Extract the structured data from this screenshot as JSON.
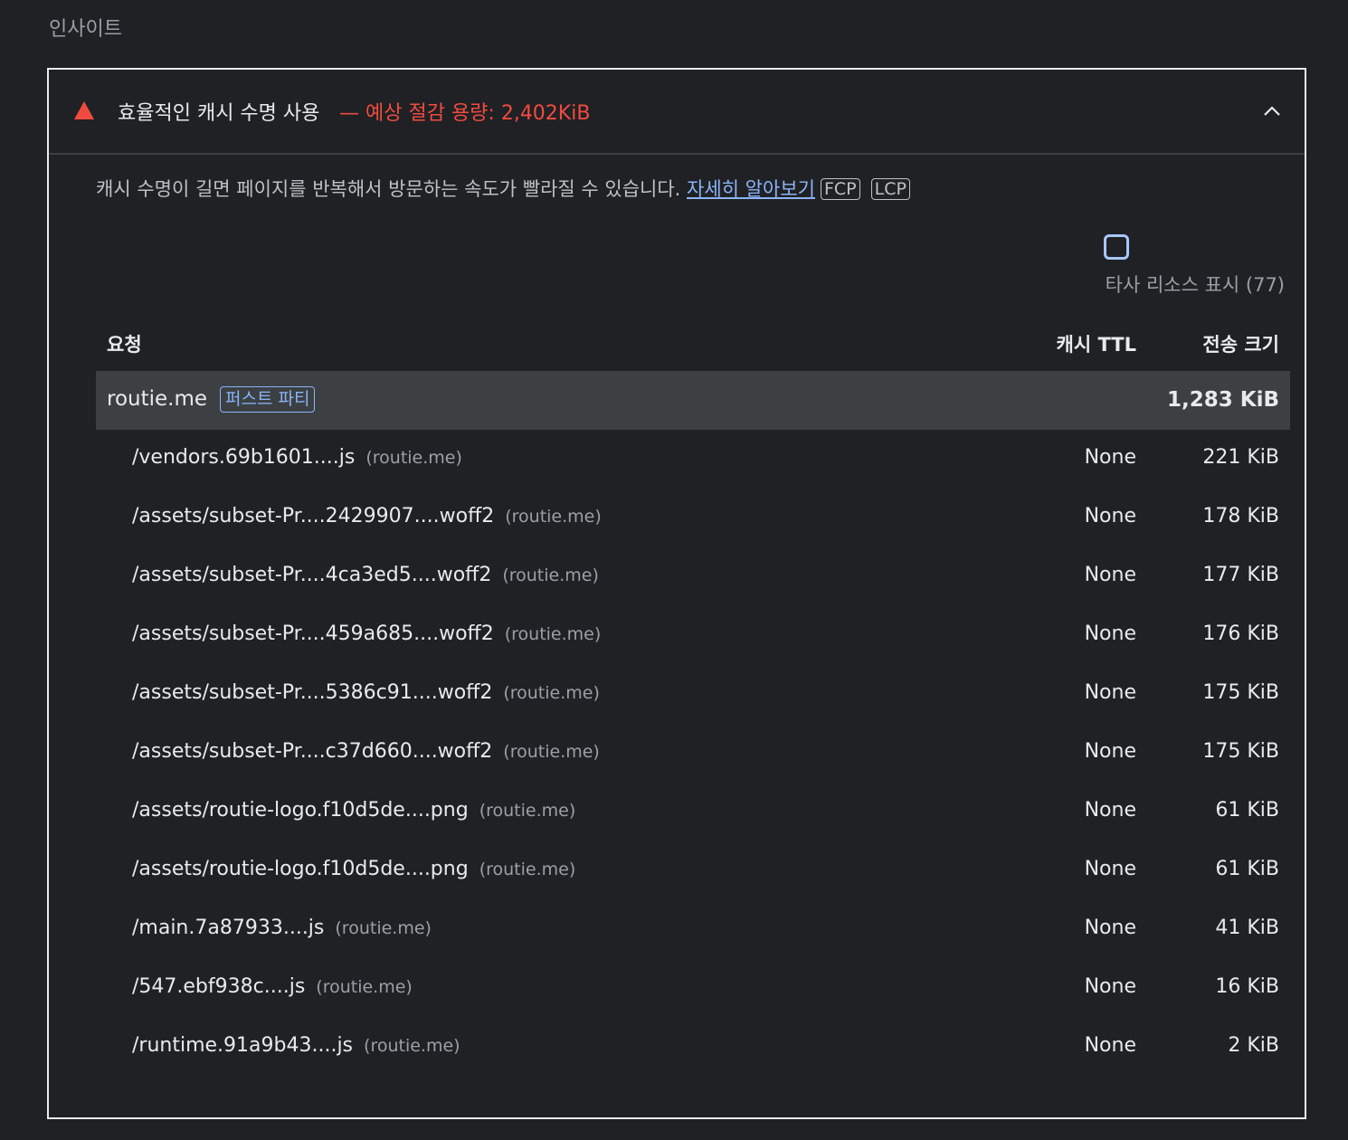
{
  "section_title": "인사이트",
  "insight": {
    "title": "효율적인 캐시 수명 사용",
    "savings": "— 예상 절감 용량: 2,402KiB",
    "description": "캐시 수명이 길면 페이지를 반복해서 방문하는 속도가 빨라질 수 있습니다.",
    "learn_more": "자세히 알아보기",
    "metrics": [
      "FCP",
      "LCP"
    ],
    "warning_color": "#f14b40",
    "expanded": true
  },
  "third_party": {
    "label": "타사 리소스 표시 (77)",
    "checked": false
  },
  "table": {
    "headers": {
      "request": "요청",
      "ttl": "캐시 TTL",
      "size": "전송 크기"
    },
    "group": {
      "name": "routie.me",
      "badge": "퍼스트 파티",
      "size": "1,283 KiB"
    },
    "rows": [
      {
        "url": "/vendors.69b1601....js",
        "origin": "(routie.me)",
        "ttl": "None",
        "size": "221 KiB"
      },
      {
        "url": "/assets/subset-Pr....2429907....woff2",
        "origin": "(routie.me)",
        "ttl": "None",
        "size": "178 KiB"
      },
      {
        "url": "/assets/subset-Pr....4ca3ed5....woff2",
        "origin": "(routie.me)",
        "ttl": "None",
        "size": "177 KiB"
      },
      {
        "url": "/assets/subset-Pr....459a685....woff2",
        "origin": "(routie.me)",
        "ttl": "None",
        "size": "176 KiB"
      },
      {
        "url": "/assets/subset-Pr....5386c91....woff2",
        "origin": "(routie.me)",
        "ttl": "None",
        "size": "175 KiB"
      },
      {
        "url": "/assets/subset-Pr....c37d660....woff2",
        "origin": "(routie.me)",
        "ttl": "None",
        "size": "175 KiB"
      },
      {
        "url": "/assets/routie-logo.f10d5de....png",
        "origin": "(routie.me)",
        "ttl": "None",
        "size": "61 KiB"
      },
      {
        "url": "/assets/routie-logo.f10d5de....png",
        "origin": "(routie.me)",
        "ttl": "None",
        "size": "61 KiB"
      },
      {
        "url": "/main.7a87933....js",
        "origin": "(routie.me)",
        "ttl": "None",
        "size": "41 KiB"
      },
      {
        "url": "/547.ebf938c....js",
        "origin": "(routie.me)",
        "ttl": "None",
        "size": "16 KiB"
      },
      {
        "url": "/runtime.91a9b43....js",
        "origin": "(routie.me)",
        "ttl": "None",
        "size": "2 KiB"
      }
    ]
  }
}
